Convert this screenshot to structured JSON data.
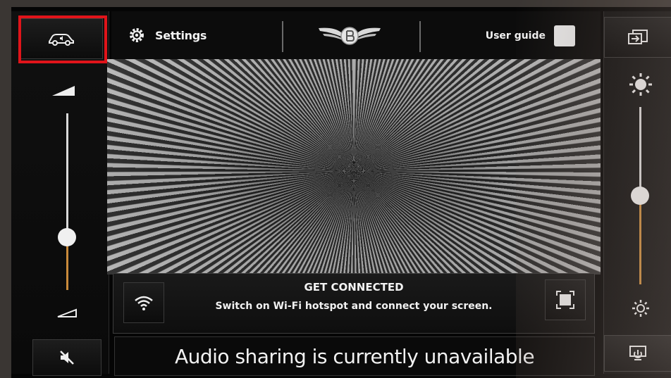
{
  "top_bar": {
    "settings_label": "Settings",
    "user_guide_label": "User guide"
  },
  "connect": {
    "title": "GET CONNECTED",
    "message": "Switch on Wi-Fi hotspot and connect your screen."
  },
  "audio": {
    "message": "Audio sharing is currently unavailable"
  },
  "sliders": {
    "volume_level": 0.3,
    "brightness_level": 0.5
  },
  "icons": {
    "car_audio": "car-audio-icon",
    "settings": "gear-icon",
    "brand_logo": "winged-b-logo-icon",
    "exit": "exit-icon",
    "brightness_high": "sun-icon",
    "brightness_low": "sun-small-icon",
    "volume_high": "volume-high-icon",
    "volume_low": "volume-low-icon",
    "mute": "mute-icon",
    "wifi": "wifi-icon",
    "fullscreen": "fullscreen-icon",
    "power": "power-icon"
  },
  "colors": {
    "highlight": "#e0141a",
    "slider_fill": "#c98a3a"
  }
}
